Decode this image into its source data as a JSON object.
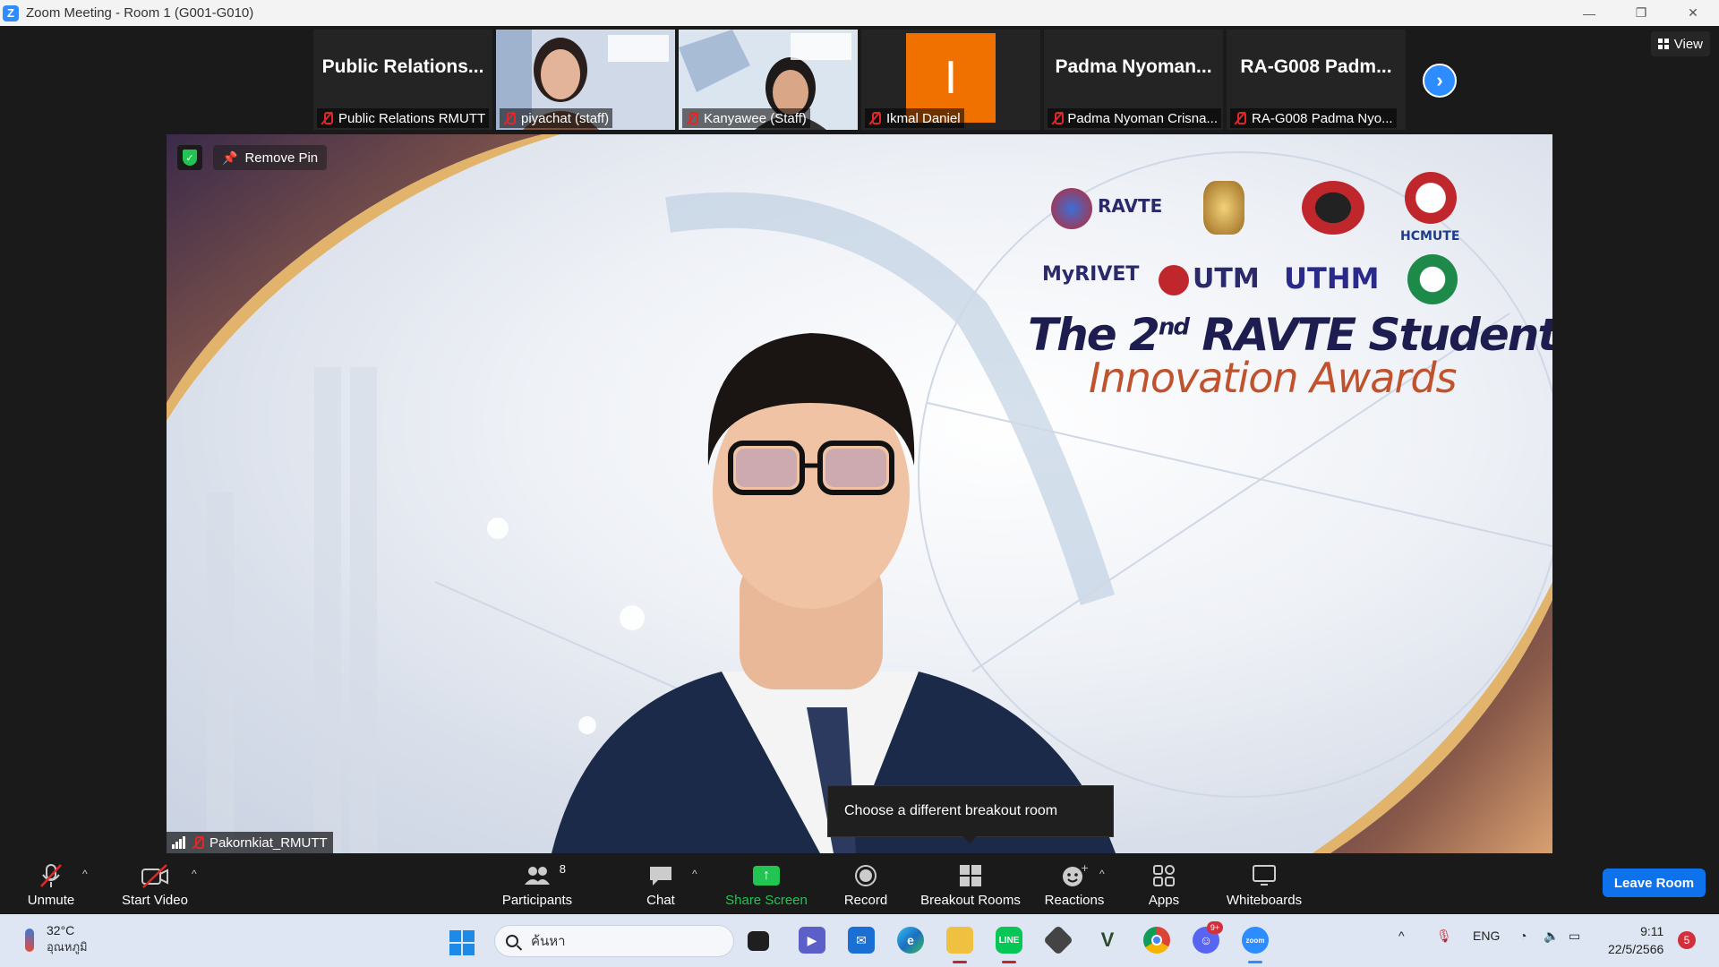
{
  "window": {
    "title": "Zoom Meeting - Room 1 (G001-G010)",
    "app_icon": "Z"
  },
  "thumbnails": [
    {
      "big_name": "Public  Relations...",
      "label": "Public Relations RMUTT",
      "muted": true
    },
    {
      "big_name": "",
      "label": "piyachat (staff)",
      "muted": true
    },
    {
      "big_name": "",
      "label": "Kanyawee (Staff)",
      "muted": true
    },
    {
      "big_name": "",
      "label": "Ikmal Daniel",
      "muted": true,
      "avatar_letter": "I",
      "avatar_color": "#f07000"
    },
    {
      "big_name": "Padma  Nyoman...",
      "label": "Padma Nyoman Crisna...",
      "muted": true
    },
    {
      "big_name": "RA-G008  Padm...",
      "label": "RA-G008 Padma Nyo...",
      "muted": true
    }
  ],
  "view_button": "View",
  "main_video": {
    "remove_pin": "Remove Pin",
    "speaker_name": "Pakornkiat_RMUTT",
    "slide": {
      "line1_pre": "The 2",
      "line1_sup": "nd",
      "line1_post": " RAVTE Students",
      "line2": "Innovation Awards",
      "logos": [
        "RAVTE",
        "MyRIVET",
        "UTM",
        "UTHM",
        "HCMUTE"
      ]
    }
  },
  "tooltip": "Choose a different breakout room",
  "toolbar": {
    "unmute": "Unmute",
    "start_video": "Start Video",
    "participants": "Participants",
    "participants_count": "8",
    "chat": "Chat",
    "share_screen": "Share Screen",
    "record": "Record",
    "breakout_rooms": "Breakout Rooms",
    "reactions": "Reactions",
    "apps": "Apps",
    "whiteboards": "Whiteboards",
    "leave_room": "Leave Room"
  },
  "taskbar": {
    "temperature": "32°C",
    "weather_label": "อุณหภูมิ",
    "search_placeholder": "ค้นหา",
    "language": "ENG",
    "time": "9:11",
    "date": "22/5/2566",
    "notifications": "5",
    "discord_badge": "9+",
    "zoom_label": "zoom"
  },
  "colors": {
    "accent": "#2d8cff",
    "share_green": "#23c552",
    "leave_blue": "#0e72ed",
    "muted_red": "#e02828"
  }
}
